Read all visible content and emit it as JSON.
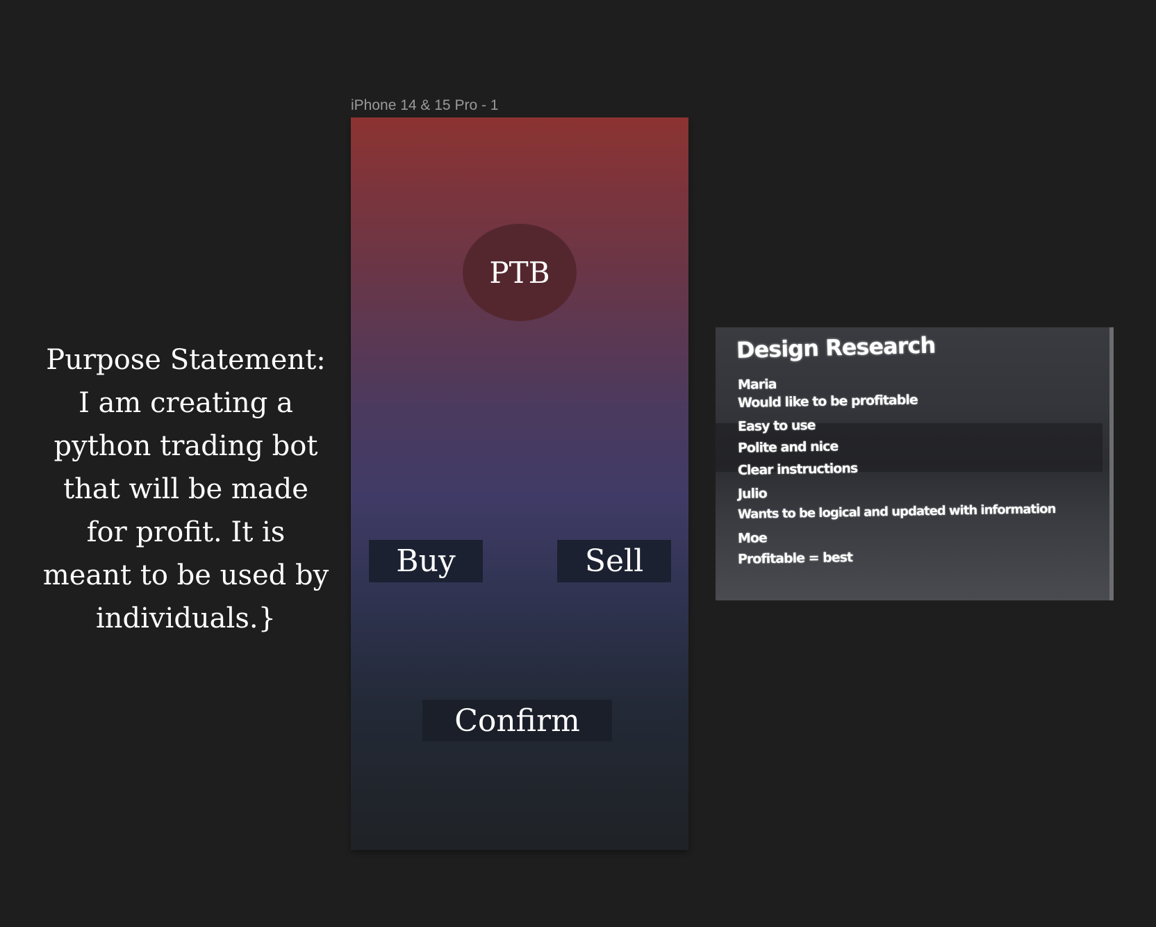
{
  "canvas": {
    "frame_label": "iPhone 14 & 15 Pro - 1"
  },
  "phone": {
    "logo_text": "PTB",
    "buy_label": "Buy",
    "sell_label": "Sell",
    "confirm_label": "Confirm",
    "gradient_colors": [
      "#8c3332",
      "#403b66",
      "#1f2226"
    ]
  },
  "purpose_statement": "Purpose Statement: I am creating a python trading bot that will be made for profit. It is meant to be used by individuals.}",
  "design_research": {
    "title": "Design Research",
    "lines": [
      "Maria",
      "Would like to be profitable",
      "Easy to use",
      "Polite and nice",
      "Clear instructions",
      "Julio",
      "Wants to be logical and updated with information",
      "Moe",
      "Profitable = best"
    ]
  }
}
